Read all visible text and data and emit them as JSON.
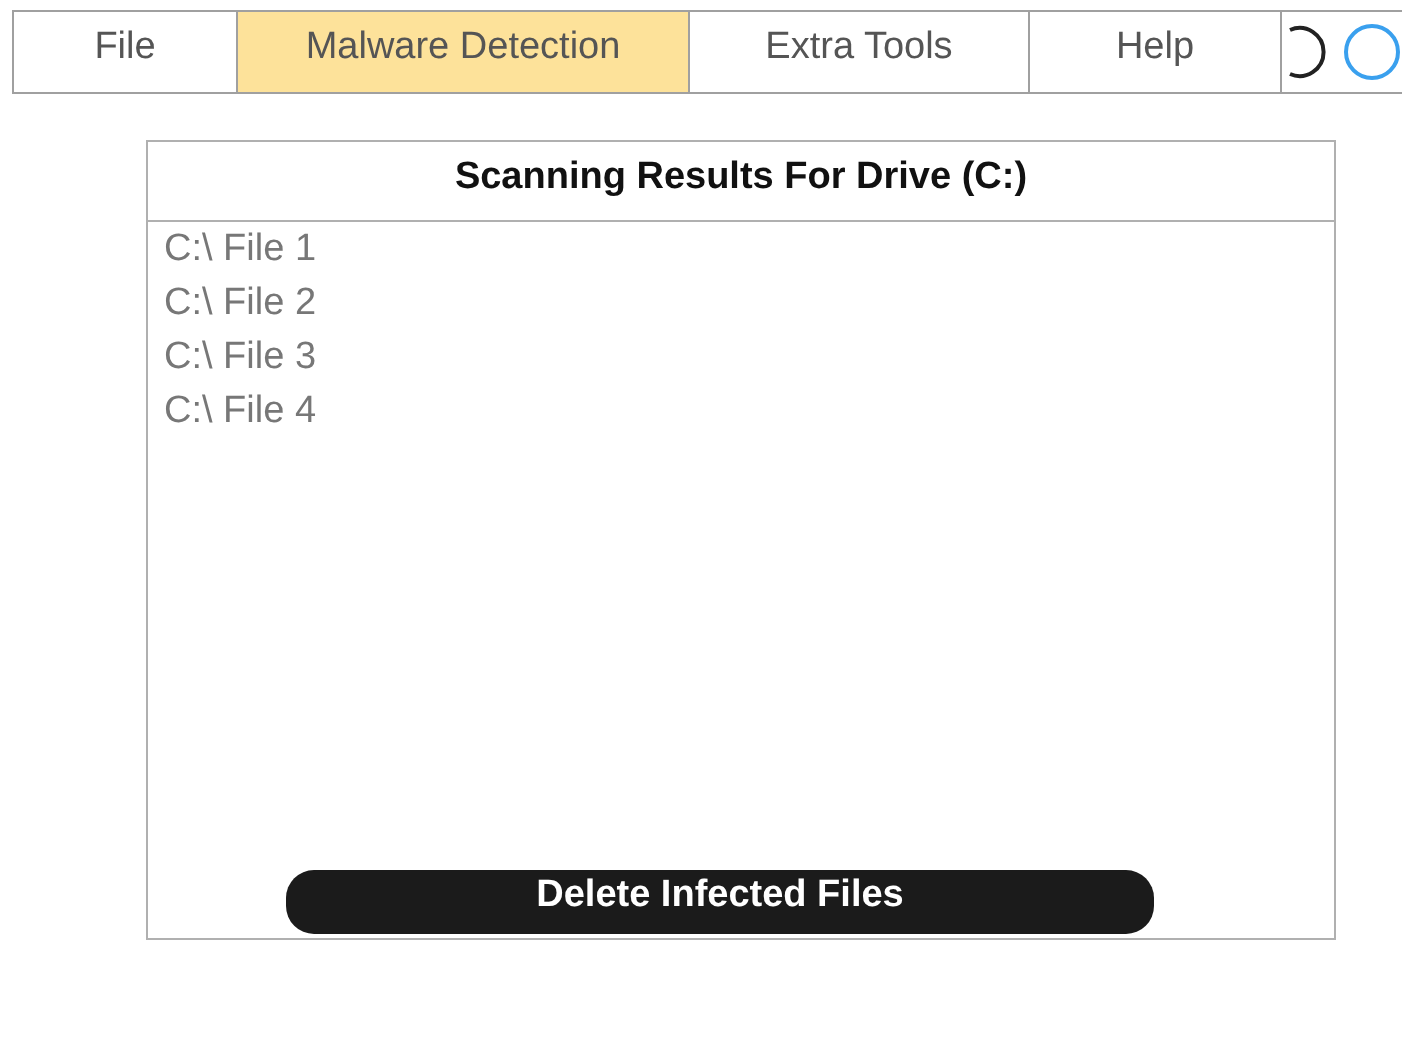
{
  "menu": [
    {
      "label": "File",
      "selected": false
    },
    {
      "label": "Malware Detection",
      "selected": true
    },
    {
      "label": "Extra Tools",
      "selected": false
    },
    {
      "label": "Help",
      "selected": false
    }
  ],
  "panel": {
    "title": "Scanning Results For Drive (C:)",
    "files": [
      "C:\\ File 1",
      "C:\\ File 2",
      "C:\\ File 3",
      "C:\\ File 4"
    ],
    "button": "Delete Infected Files"
  }
}
